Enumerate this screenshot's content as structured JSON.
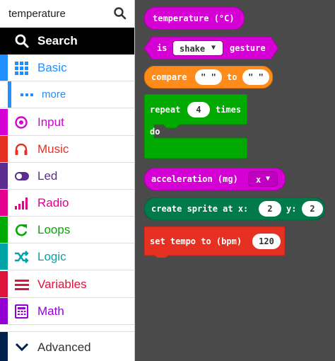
{
  "search": {
    "query": "temperature"
  },
  "categories": [
    {
      "label": "Search",
      "icon": "search-icon",
      "color": "#000000"
    },
    {
      "label": "Basic",
      "icon": "grid-icon",
      "color": "#1e90ff"
    },
    {
      "label": "more",
      "icon": "ellipsis-icon",
      "color": "#1e90ff"
    },
    {
      "label": "Input",
      "icon": "target-icon",
      "color": "#d400d4"
    },
    {
      "label": "Music",
      "icon": "headphones-icon",
      "color": "#e63022"
    },
    {
      "label": "Led",
      "icon": "toggle-icon",
      "color": "#5c2d91"
    },
    {
      "label": "Radio",
      "icon": "signal-icon",
      "color": "#e3008c"
    },
    {
      "label": "Loops",
      "icon": "refresh-icon",
      "color": "#00aa00"
    },
    {
      "label": "Logic",
      "icon": "shuffle-icon",
      "color": "#00a4a6"
    },
    {
      "label": "Variables",
      "icon": "list-icon",
      "color": "#dc143c"
    },
    {
      "label": "Math",
      "icon": "calculator-icon",
      "color": "#9400d3"
    },
    {
      "label": "Advanced",
      "icon": "chevron-down-icon",
      "color": "#002050"
    }
  ],
  "blocks": {
    "temperature": {
      "label": "temperature (°C)",
      "color": "#d400d4"
    },
    "gesture": {
      "prefix": "is",
      "dropdown": "shake",
      "suffix": "gesture",
      "color": "#d400d4"
    },
    "compare": {
      "label": "compare",
      "first": "\" \"",
      "middle": "to",
      "second": "\" \"",
      "color": "#ff8c1a"
    },
    "repeat": {
      "label": "repeat",
      "count": "4",
      "suffix": "times",
      "do_label": "do",
      "color": "#00aa00"
    },
    "acceleration": {
      "label": "acceleration (mg)",
      "dropdown": "x",
      "color": "#d400d4"
    },
    "sprite": {
      "label": "create sprite at x:",
      "x_value": "2",
      "y_label": "y:",
      "y_value": "2",
      "color": "#007a4b"
    },
    "tempo": {
      "label": "set tempo to (bpm)",
      "value": "120",
      "color": "#e63022"
    }
  }
}
